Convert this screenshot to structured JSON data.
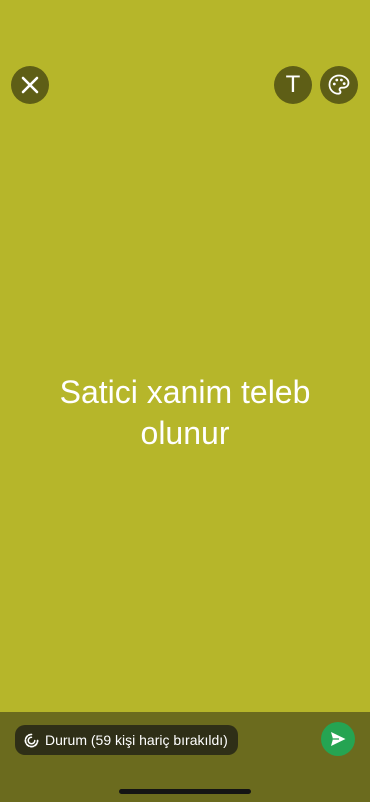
{
  "colors": {
    "background": "#b6b62a",
    "toolbar_button": "#5e5e16",
    "bottom_bar": "#6b6b1e",
    "pill": "#2f2f17",
    "send": "#25a452"
  },
  "toolbar": {
    "close_icon": "close-icon",
    "text_tool_label": "T",
    "palette_icon": "palette-icon"
  },
  "status": {
    "text": "Satici xanim teleb olunur"
  },
  "footer": {
    "audience_label": "Durum (59 kişi hariç bırakıldı)",
    "audience_icon": "status-ring-icon",
    "send_icon": "send-icon"
  }
}
